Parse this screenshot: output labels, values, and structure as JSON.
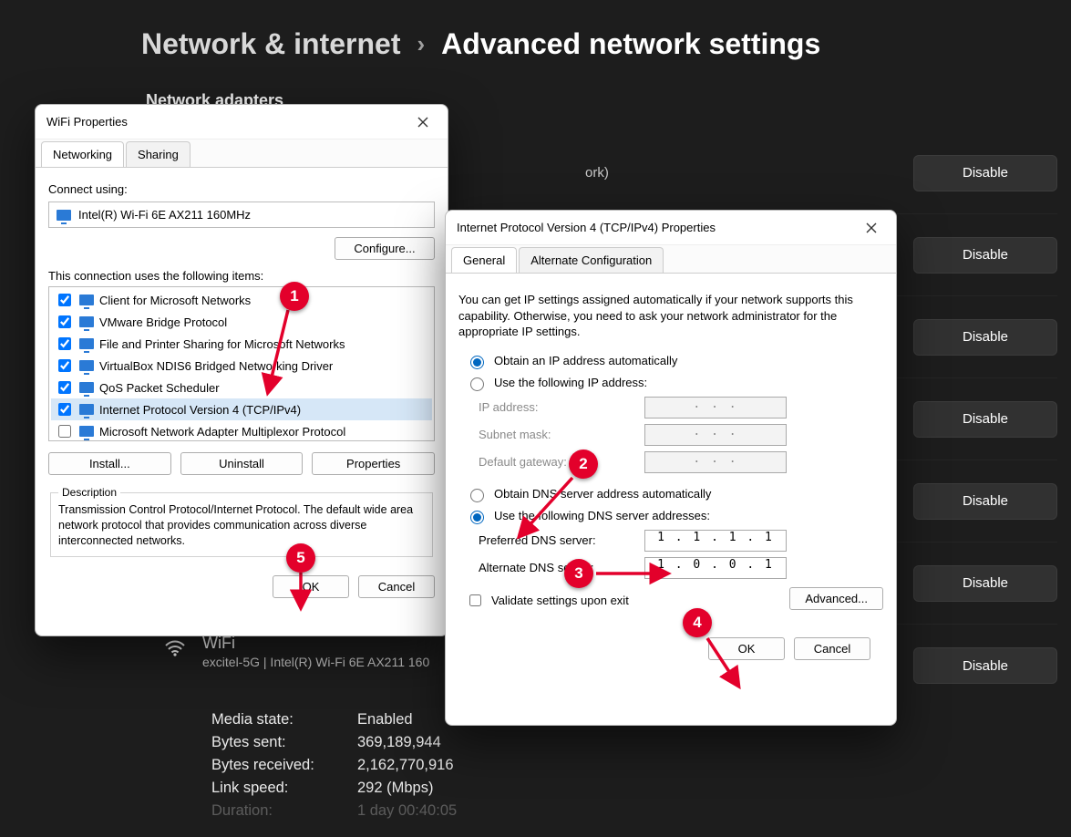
{
  "settings": {
    "breadcrumb_parent": "Network & internet",
    "breadcrumb_current": "Advanced network settings",
    "section_label": "Network adapters",
    "disable_label": "Disable",
    "wifi": {
      "title": "WiFi",
      "subtitle": "excitel-5G | Intel(R) Wi-Fi 6E AX211 160",
      "side_text": "ork)",
      "stats": {
        "media_state_lbl": "Media state:",
        "media_state_val": "Enabled",
        "bytes_sent_lbl": "Bytes sent:",
        "bytes_sent_val": "369,189,944",
        "bytes_recv_lbl": "Bytes received:",
        "bytes_recv_val": "2,162,770,916",
        "link_speed_lbl": "Link speed:",
        "link_speed_val": "292 (Mbps)",
        "duration_lbl": "Duration:",
        "duration_val": "1 day 00:40:05"
      }
    }
  },
  "dlg1": {
    "title": "WiFi Properties",
    "tabs": {
      "networking": "Networking",
      "sharing": "Sharing"
    },
    "connect_using_label": "Connect using:",
    "adapter_name": "Intel(R) Wi-Fi 6E AX211 160MHz",
    "configure_btn": "Configure...",
    "items_label": "This connection uses the following items:",
    "items": [
      {
        "label": "Client for Microsoft Networks",
        "checked": true
      },
      {
        "label": "VMware Bridge Protocol",
        "checked": true
      },
      {
        "label": "File and Printer Sharing for Microsoft Networks",
        "checked": true
      },
      {
        "label": "VirtualBox NDIS6 Bridged Networking Driver",
        "checked": true
      },
      {
        "label": "QoS Packet Scheduler",
        "checked": true
      },
      {
        "label": "Internet Protocol Version 4 (TCP/IPv4)",
        "checked": true,
        "selected": true
      },
      {
        "label": "Microsoft Network Adapter Multiplexor Protocol",
        "checked": false
      }
    ],
    "install_btn": "Install...",
    "uninstall_btn": "Uninstall",
    "properties_btn": "Properties",
    "description_label": "Description",
    "description_text": "Transmission Control Protocol/Internet Protocol. The default wide area network protocol that provides communication across diverse interconnected networks.",
    "ok_btn": "OK",
    "cancel_btn": "Cancel"
  },
  "dlg2": {
    "title": "Internet Protocol Version 4 (TCP/IPv4) Properties",
    "tabs": {
      "general": "General",
      "alt": "Alternate Configuration"
    },
    "intro": "You can get IP settings assigned automatically if your network supports this capability. Otherwise, you need to ask your network administrator for the appropriate IP settings.",
    "ip_auto": "Obtain an IP address automatically",
    "ip_manual": "Use the following IP address:",
    "ip_address_lbl": "IP address:",
    "subnet_lbl": "Subnet mask:",
    "gateway_lbl": "Default gateway:",
    "dns_auto": "Obtain DNS server address automatically",
    "dns_manual": "Use the following DNS server addresses:",
    "dns_pref_lbl": "Preferred DNS server:",
    "dns_pref_val": "1 . 1 . 1 . 1",
    "dns_alt_lbl": "Alternate DNS server:",
    "dns_alt_val": "1 . 0 . 0 . 1",
    "validate_lbl": "Validate settings upon exit",
    "advanced_btn": "Advanced...",
    "ok_btn": "OK",
    "cancel_btn": "Cancel",
    "ip_dots": ".       .       ."
  },
  "annotations": {
    "b1": "1",
    "b2": "2",
    "b3": "3",
    "b4": "4",
    "b5": "5"
  }
}
